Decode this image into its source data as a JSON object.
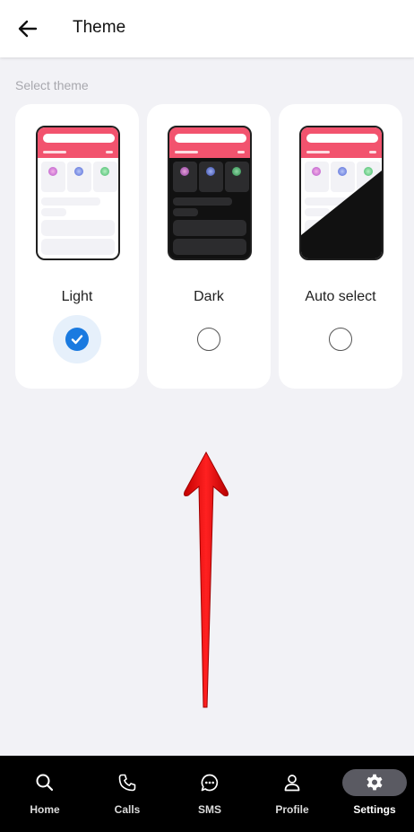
{
  "header": {
    "title": "Theme"
  },
  "section_label": "Select theme",
  "options": [
    {
      "label": "Light",
      "selected": true
    },
    {
      "label": "Dark",
      "selected": false
    },
    {
      "label": "Auto select",
      "selected": false
    }
  ],
  "nav": [
    {
      "label": "Home",
      "icon": "search-icon",
      "active": false
    },
    {
      "label": "Calls",
      "icon": "phone-icon",
      "active": false
    },
    {
      "label": "SMS",
      "icon": "chat-icon",
      "active": false
    },
    {
      "label": "Profile",
      "icon": "person-icon",
      "active": false
    },
    {
      "label": "Settings",
      "icon": "gear-icon",
      "active": true
    }
  ],
  "colors": {
    "accent": "#1a7ae0",
    "preview_header": "#f2536e",
    "annotation_arrow": "#e01414"
  }
}
